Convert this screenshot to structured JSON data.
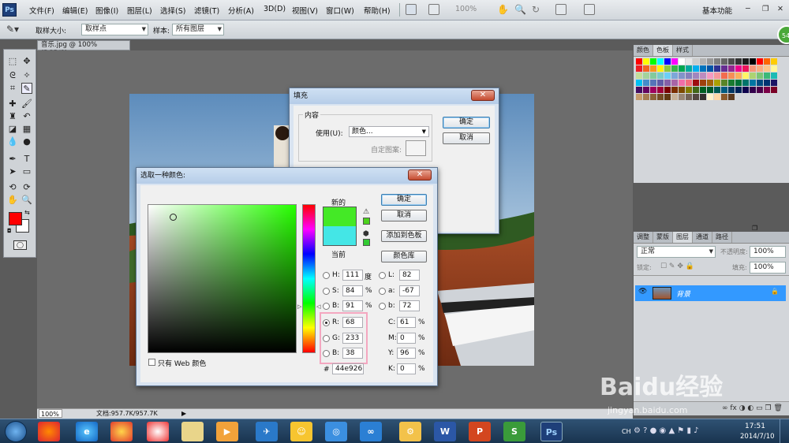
{
  "app": {
    "logo": "Ps"
  },
  "menu": {
    "items": [
      "文件(F)",
      "编辑(E)",
      "图像(I)",
      "图层(L)",
      "选择(S)",
      "滤镜(T)",
      "分析(A)",
      "3D(D)",
      "视图(V)",
      "窗口(W)",
      "帮助(H)"
    ],
    "zoom": "100%",
    "workspace": "基本功能"
  },
  "options": {
    "sample_size_label": "取样大小:",
    "sample_size_value": "取样点",
    "sample_label": "样本:",
    "sample_value": "所有图层"
  },
  "document": {
    "tab": "音乐.jpg @ 100%(RGB/8)",
    "status_zoom": "100%",
    "status_doc": "文档:957.7K/957.7K"
  },
  "panels": {
    "top_tabs": [
      "颜色",
      "色板",
      "样式"
    ],
    "layer_tabs": [
      "调整",
      "蒙版",
      "图层",
      "通道",
      "路径"
    ],
    "blend_mode": "正常",
    "opacity_label": "不透明度:",
    "opacity": "100%",
    "lock_label": "锁定:",
    "fill_label": "填充:",
    "fill": "100%",
    "layer_name": "背景",
    "swatch_colors": [
      "#ff0000",
      "#ffff00",
      "#00ff00",
      "#00ffff",
      "#0000ff",
      "#ff00ff",
      "#ffffff",
      "#e6e6e6",
      "#cccccc",
      "#b3b3b3",
      "#999999",
      "#808080",
      "#666666",
      "#4d4d4d",
      "#333333",
      "#1a1a1a",
      "#000000",
      "#ff0000",
      "#ff6600",
      "#ffcc00",
      "#ed1c24",
      "#f26522",
      "#f7941d",
      "#fff200",
      "#8dc63f",
      "#39b54a",
      "#00a651",
      "#00a99d",
      "#00aeef",
      "#0072bc",
      "#0054a6",
      "#2e3192",
      "#662d91",
      "#92278f",
      "#ec008c",
      "#ed145b",
      "#f69679",
      "#f9ad81",
      "#fdc689",
      "#fff799",
      "#c4df9b",
      "#a3d39c",
      "#82ca9d",
      "#7accc8",
      "#6dcff6",
      "#7da7d9",
      "#8393ca",
      "#8781bd",
      "#a186be",
      "#bd8cbf",
      "#f49ac1",
      "#f5989d",
      "#f26c4f",
      "#f68e56",
      "#fbaf5d",
      "#fff568",
      "#acd373",
      "#7cc576",
      "#3cb878",
      "#1cbbb4",
      "#00bff3",
      "#448ccb",
      "#5674b9",
      "#605ca8",
      "#855fa8",
      "#a864a8",
      "#f06ea9",
      "#f26d7d",
      "#9e0b0f",
      "#a0410d",
      "#a3620a",
      "#aba000",
      "#598527",
      "#197b30",
      "#007236",
      "#00746b",
      "#0076a3",
      "#004b80",
      "#003471",
      "#1b1464",
      "#440e62",
      "#630460",
      "#9e005d",
      "#9e0039",
      "#790000",
      "#7b2e00",
      "#7d4900",
      "#827b00",
      "#406618",
      "#005e20",
      "#005826",
      "#005952",
      "#005b7f",
      "#003663",
      "#002157",
      "#0d004c",
      "#32004b",
      "#4b0049",
      "#7b0046",
      "#7a0026",
      "#c69c6d",
      "#a67c52",
      "#8c6239",
      "#754c24",
      "#603913",
      "#c7b299",
      "#998675",
      "#736357",
      "#534741",
      "#362f2d",
      "#fff2cc",
      "#ffd8a8",
      "#8b5a2b",
      "#5c3a1e"
    ]
  },
  "fill_dialog": {
    "title": "填充",
    "group_label": "内容",
    "use_label": "使用(U):",
    "use_value": "颜色...",
    "pattern_label": "自定图案:",
    "ok": "确定",
    "cancel": "取消"
  },
  "picker": {
    "title": "选取一种颜色:",
    "new_label": "新的",
    "current_label": "当前",
    "new_color": "#44e926",
    "current_color": "#44e6e6",
    "ok": "确定",
    "cancel": "取消",
    "add_swatch": "添加到色板",
    "library": "颜色库",
    "web_only": "只有 Web 颜色",
    "hue_pos": 0.69,
    "h": {
      "label": "H:",
      "value": "111",
      "unit": "度"
    },
    "s": {
      "label": "S:",
      "value": "84",
      "unit": "%"
    },
    "b": {
      "label": "B:",
      "value": "91",
      "unit": "%"
    },
    "r": {
      "label": "R:",
      "value": "68"
    },
    "g": {
      "label": "G:",
      "value": "233"
    },
    "bl": {
      "label": "B:",
      "value": "38"
    },
    "l": {
      "label": "L:",
      "value": "82"
    },
    "a": {
      "label": "a:",
      "value": "-67"
    },
    "b2": {
      "label": "b:",
      "value": "72"
    },
    "c": {
      "label": "C:",
      "value": "61",
      "unit": "%"
    },
    "m": {
      "label": "M:",
      "value": "0",
      "unit": "%"
    },
    "y": {
      "label": "Y:",
      "value": "96",
      "unit": "%"
    },
    "k": {
      "label": "K:",
      "value": "0",
      "unit": "%"
    },
    "hex_label": "#",
    "hex": "44e926",
    "highlight_color": "#f4a7c0"
  },
  "taskbar": {
    "lang": "CH",
    "time": "17:51",
    "date": "2014/7/10",
    "apps": [
      "W",
      "P",
      "S",
      "Ps"
    ]
  },
  "watermark": {
    "text": "Baidu经验",
    "url": "jingyan.baidu.com"
  }
}
